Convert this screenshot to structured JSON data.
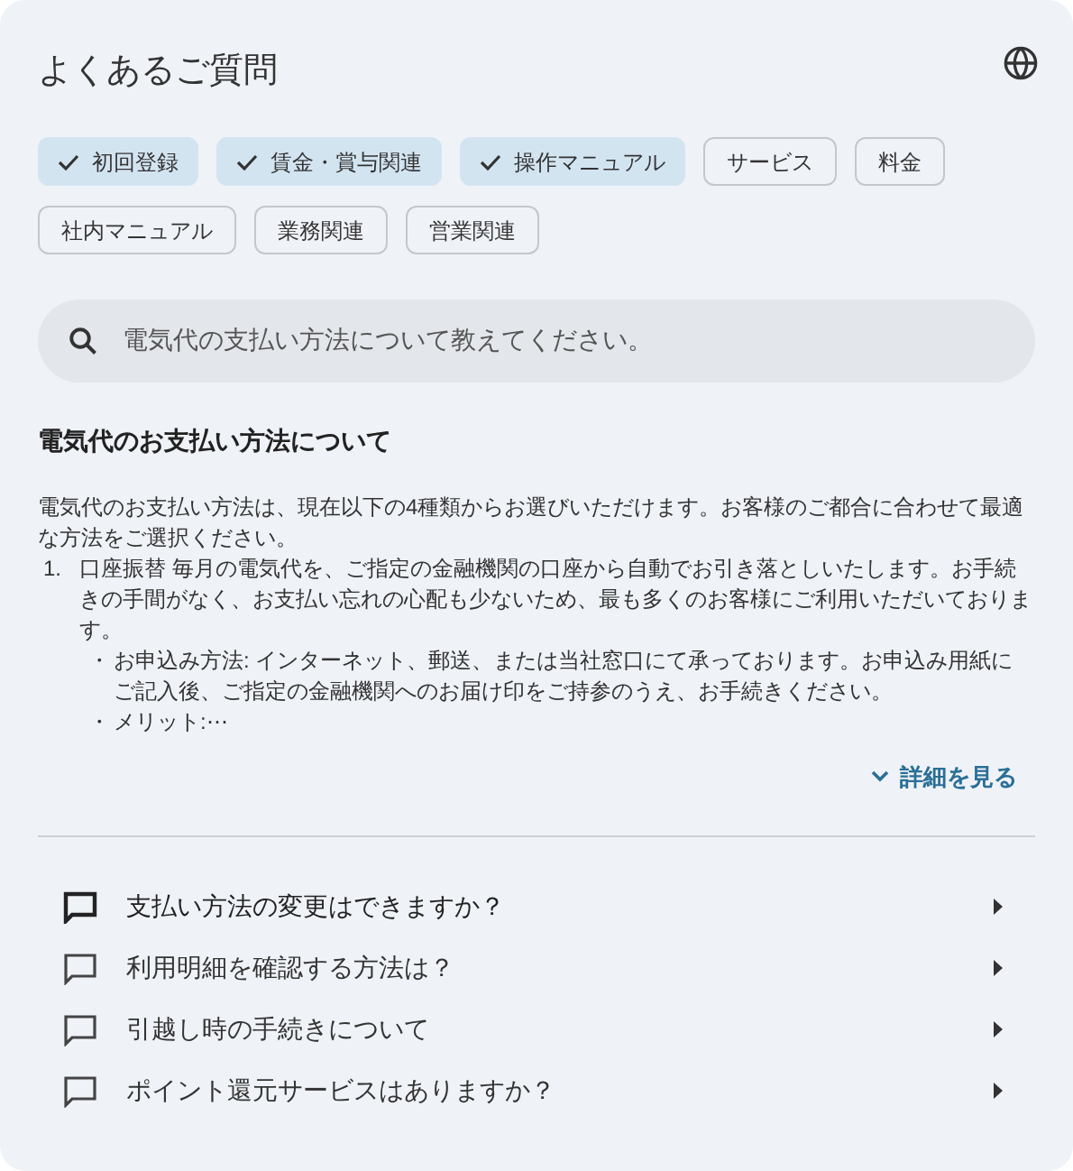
{
  "header": {
    "title": "よくあるご質問"
  },
  "filters": [
    {
      "label": "初回登録",
      "selected": true
    },
    {
      "label": "賃金・賞与関連",
      "selected": true
    },
    {
      "label": "操作マニュアル",
      "selected": true
    },
    {
      "label": "サービス",
      "selected": false
    },
    {
      "label": "料金",
      "selected": false
    },
    {
      "label": "社内マニュアル",
      "selected": false
    },
    {
      "label": "業務関連",
      "selected": false
    },
    {
      "label": "営業関連",
      "selected": false
    }
  ],
  "search": {
    "value": "電気代の支払い方法について教えてください。"
  },
  "answer": {
    "title": "電気代のお支払い方法について",
    "intro": "電気代のお支払い方法は、現在以下の4種類からお選びいただけます。お客様のご都合に合わせて最適な方法をご選択ください。",
    "items": [
      {
        "marker": "1.",
        "text": "口座振替 毎月の電気代を、ご指定の金融機関の口座から自動でお引き落としいたします。お手続きの手間がなく、お支払い忘れの心配も少ないため、最も多くのお客様にご利用いただいております。",
        "bullets": [
          {
            "marker": "・",
            "text": "お申込み方法: インターネット、郵送、または当社窓口にて承っております。お申込み用紙にご記入後、ご指定の金融機関へのお届け印をご持参のうえ、お手続きください。"
          },
          {
            "marker": "・",
            "text": "メリット:⋯"
          }
        ]
      }
    ],
    "more_link": "詳細を見る"
  },
  "related_questions": [
    {
      "text": "支払い方法の変更はできますか？",
      "selected": true
    },
    {
      "text": "利用明細を確認する方法は？",
      "selected": false
    },
    {
      "text": "引越し時の手続きについて",
      "selected": false
    },
    {
      "text": "ポイント還元サービスはありますか？",
      "selected": false
    }
  ]
}
